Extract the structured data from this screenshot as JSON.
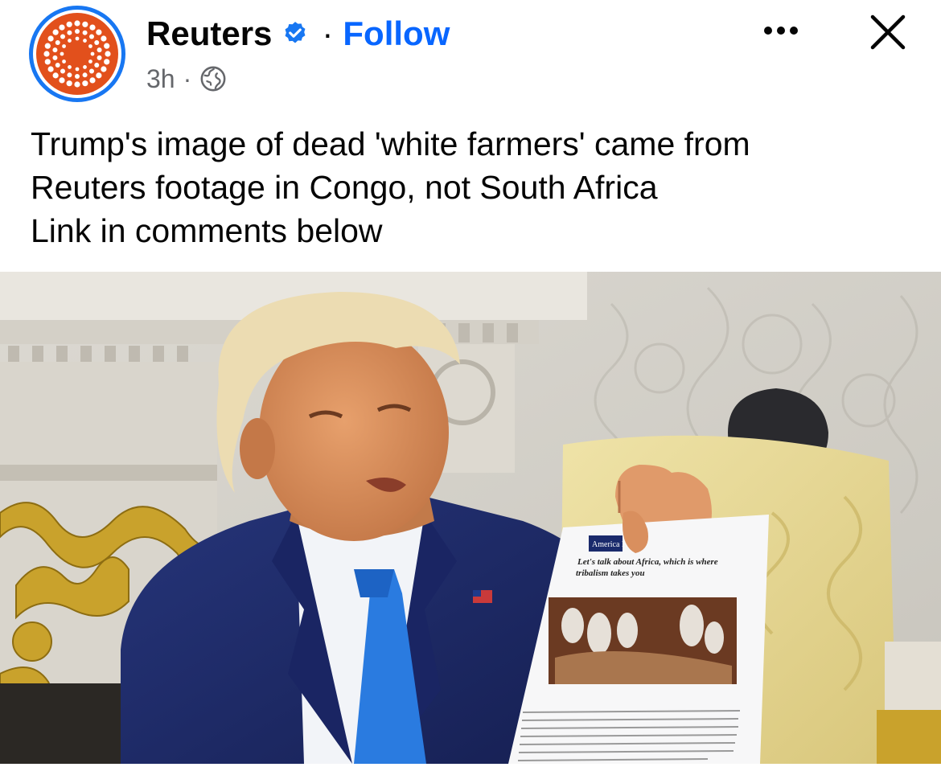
{
  "post": {
    "page_name": "Reuters",
    "follow_label": "Follow",
    "separator": "·",
    "time": "3h",
    "audience_icon": "globe-icon",
    "text_lines": [
      "Trump's image of dead 'white farmers' came from",
      "Reuters footage in Congo, not South Africa",
      "Link in comments below"
    ]
  },
  "photo": {
    "paper_lines": [
      "America First",
      "Let's talk about Africa, which is where",
      "tribalism takes you"
    ]
  },
  "colors": {
    "brand_orange": "#e2501c",
    "link_blue": "#0866ff",
    "verified_blue": "#1877f2",
    "suit_navy": "#1e2a66",
    "tie_blue": "#2a7be0"
  }
}
